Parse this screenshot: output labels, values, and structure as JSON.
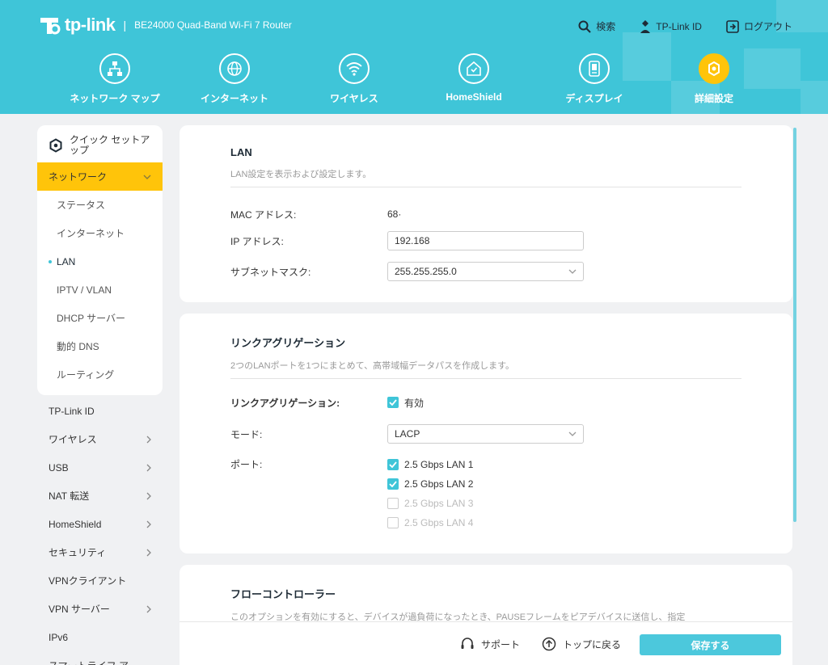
{
  "header": {
    "logo_text": "tp-link",
    "separator": "|",
    "model": "BE24000 Quad-Band Wi-Fi 7 Router",
    "search": "検索",
    "tplink_id": "TP-Link ID",
    "logout": "ログアウト"
  },
  "nav": [
    {
      "label": "ネットワーク マップ",
      "icon": "network-map-icon"
    },
    {
      "label": "インターネット",
      "icon": "globe-icon"
    },
    {
      "label": "ワイヤレス",
      "icon": "wifi-icon"
    },
    {
      "label": "HomeShield",
      "icon": "homeshield-icon"
    },
    {
      "label": "ディスプレイ",
      "icon": "display-icon"
    },
    {
      "label": "詳細設定",
      "icon": "gear-icon",
      "active": true
    }
  ],
  "sidebar": {
    "quick_setup": "クイック セットアップ",
    "active_section": "ネットワーク",
    "sub_items": [
      "ステータス",
      "インターネット",
      "LAN",
      "IPTV / VLAN",
      "DHCP サーバー",
      "動的 DNS",
      "ルーティング"
    ],
    "current_sub": "LAN",
    "items": [
      {
        "label": "TP-Link ID",
        "arrow": false
      },
      {
        "label": "ワイヤレス",
        "arrow": true
      },
      {
        "label": "USB",
        "arrow": true
      },
      {
        "label": "NAT 転送",
        "arrow": true
      },
      {
        "label": "HomeShield",
        "arrow": true
      },
      {
        "label": "セキュリティ",
        "arrow": true
      },
      {
        "label": "VPNクライアント",
        "arrow": false
      },
      {
        "label": "VPN サーバー",
        "arrow": true
      },
      {
        "label": "IPv6",
        "arrow": false
      },
      {
        "label": "スマートライフ ア",
        "arrow": false
      }
    ]
  },
  "lan": {
    "title": "LAN",
    "desc": "LAN設定を表示および設定します。",
    "mac_label": "MAC アドレス:",
    "mac_value": "68·",
    "ip_label": "IP アドレス:",
    "ip_value": "192.168",
    "subnet_label": "サブネットマスク:",
    "subnet_value": "255.255.255.0"
  },
  "agg": {
    "title": "リンクアグリゲーション",
    "desc": "2つのLANポートを1つにまとめて、高帯域幅データパスを作成します。",
    "enable_label": "リンクアグリゲーション:",
    "enable_value": "有効",
    "mode_label": "モード:",
    "mode_value": "LACP",
    "port_label": "ポート:",
    "ports": [
      {
        "label": "2.5 Gbps LAN 1",
        "checked": true,
        "disabled": false
      },
      {
        "label": "2.5 Gbps LAN 2",
        "checked": true,
        "disabled": false
      },
      {
        "label": "2.5 Gbps LAN 3",
        "checked": false,
        "disabled": true
      },
      {
        "label": "2.5 Gbps LAN 4",
        "checked": false,
        "disabled": true
      }
    ]
  },
  "flow": {
    "title": "フローコントローラー",
    "desc": "このオプションを有効にすると、デバイスが過負荷になったとき、PAUSEフレームをピアデバイスに送信し、指定"
  },
  "footer": {
    "support": "サポート",
    "top": "トップに戻る",
    "save": "保存する"
  },
  "colors": {
    "accent": "#3fc5d8",
    "active": "#ffc40a"
  }
}
